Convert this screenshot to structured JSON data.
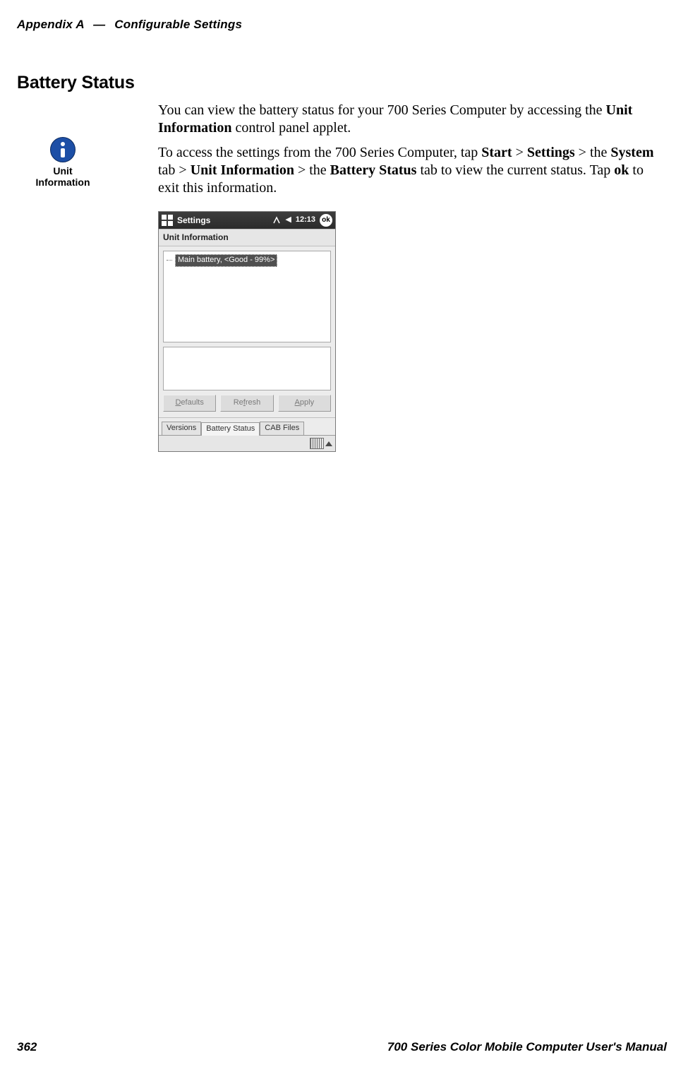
{
  "header": {
    "appendix": "Appendix",
    "letter": "A",
    "dash": "—",
    "title": "Configurable Settings"
  },
  "heading": "Battery Status",
  "para1_pre": "You can view the battery status for your 700 Series Computer by accessing the ",
  "para1_bold": "Unit Information",
  "para1_post": " control panel applet.",
  "para2": {
    "t1": "To access the settings from the 700 Series Computer, tap ",
    "b1": "Start",
    "t2": " > ",
    "b2": "Settings",
    "t3": " > the ",
    "b3": "System",
    "t4": " tab > ",
    "b4": "Unit Information",
    "t5": " > the ",
    "b5": "Battery Status",
    "t6": " tab to view the current status. Tap ",
    "b6": "ok",
    "t7": " to exit this information."
  },
  "icon_caption_line1": "Unit",
  "icon_caption_line2": "Information",
  "pda": {
    "titlebar": {
      "app": "Settings",
      "clock": "12:13",
      "ok": "ok"
    },
    "panel_title": "Unit Information",
    "tree_item": "Main battery, <Good - 99%>",
    "buttons": {
      "defaults_u": "D",
      "defaults_rest": "efaults",
      "refresh_pre": "Re",
      "refresh_u": "f",
      "refresh_rest": "resh",
      "apply_u": "A",
      "apply_rest": "pply"
    },
    "tabs": [
      "Versions",
      "Battery Status",
      "CAB Files"
    ],
    "active_tab_index": 1
  },
  "footer": {
    "page": "362",
    "manual": "700 Series Color Mobile Computer User's Manual"
  }
}
